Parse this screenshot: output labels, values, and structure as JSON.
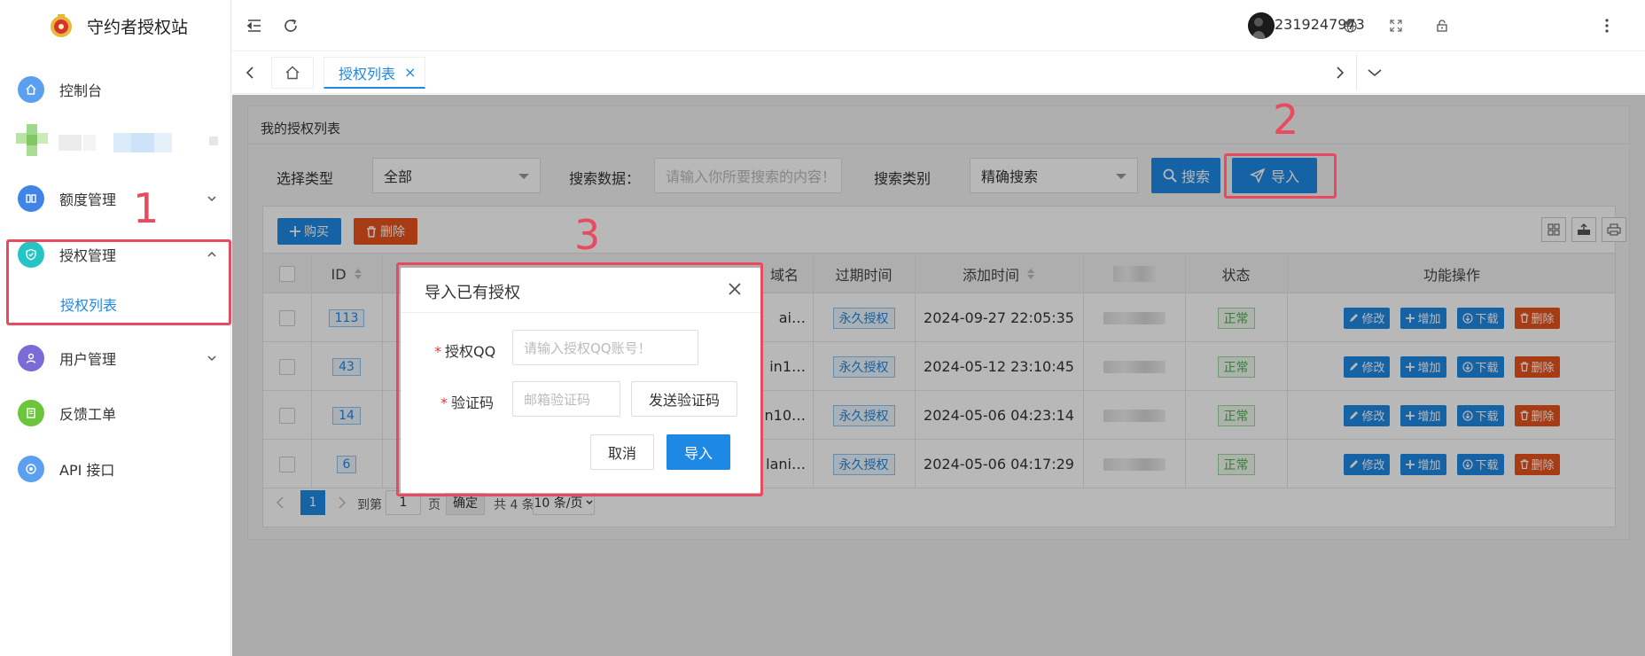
{
  "app": {
    "title": "守约者授权站"
  },
  "sidebar": {
    "items": [
      {
        "label": "控制台",
        "color": "#5b9ff0"
      },
      {
        "label": "额度管理",
        "color": "#3f84e6"
      },
      {
        "label": "授权管理",
        "color": "#25c5c5"
      },
      {
        "label": "用户管理",
        "color": "#7a6cd6"
      },
      {
        "label": "反馈工单",
        "color": "#6cc63c"
      },
      {
        "label": "API 接口",
        "color": "#5b9ff0"
      }
    ],
    "sub_item": "授权列表"
  },
  "header": {
    "username": "2319247973"
  },
  "tabs": {
    "active": "授权列表",
    "close": "×"
  },
  "card": {
    "title": "我的授权列表",
    "filter": {
      "type_label": "选择类型",
      "type_value": "全部",
      "search_label": "搜索数据：",
      "search_placeholder": "请输入你所要搜索的内容！",
      "category_label": "搜索类别",
      "category_value": "精确搜索",
      "search_button": "搜索",
      "import_button": "导入"
    },
    "toolbar": {
      "buy": "购买",
      "delete": "删除"
    }
  },
  "table": {
    "headers": {
      "id": "ID",
      "domain": "域名",
      "expire": "过期时间",
      "added": "添加时间",
      "status": "状态",
      "ops": "功能操作"
    },
    "rows": [
      {
        "id": "113",
        "domain": "ai…",
        "expire": "永久授权",
        "added": "2024-09-27 22:05:35",
        "status": "正常"
      },
      {
        "id": "43",
        "domain": "in1…",
        "expire": "永久授权",
        "added": "2024-05-12 23:10:45",
        "status": "正常"
      },
      {
        "id": "14",
        "domain": "n10…",
        "expire": "永久授权",
        "added": "2024-05-06 04:23:14",
        "status": "正常"
      },
      {
        "id": "6",
        "domain": "lani…",
        "expire": "永久授权",
        "added": "2024-05-06 04:17:29",
        "status": "正常"
      }
    ],
    "ops": {
      "edit": "修改",
      "add": "增加",
      "download": "下载",
      "delete": "删除"
    }
  },
  "pager": {
    "current": "1",
    "goto": "到第",
    "page_input": "1",
    "page": "页",
    "confirm": "确定",
    "total": "共 4 条",
    "size": "10 条/页"
  },
  "dialog": {
    "title": "导入已有授权",
    "qq_label": "授权QQ",
    "qq_placeholder": "请输入授权QQ账号！",
    "code_label": "验证码",
    "code_placeholder": "邮箱验证码",
    "send_code": "发送验证码",
    "cancel": "取消",
    "confirm": "导入"
  },
  "annotations": {
    "one": "1",
    "two": "2",
    "three": "3"
  }
}
